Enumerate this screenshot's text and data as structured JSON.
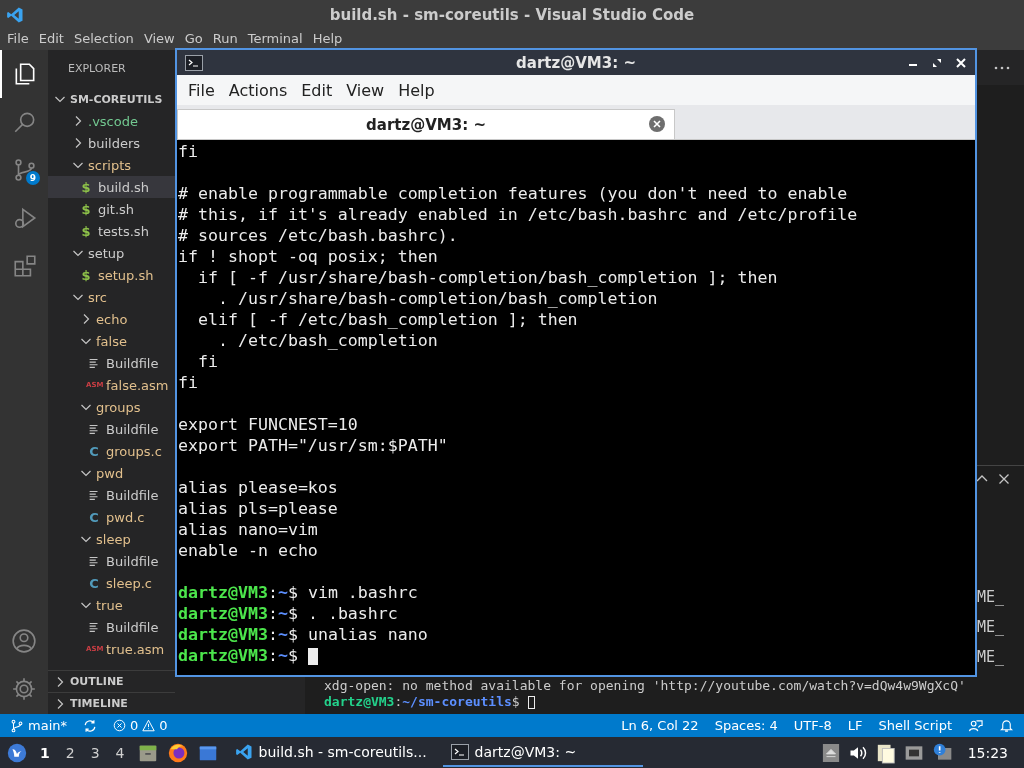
{
  "vscode": {
    "title": "build.sh - sm-coreutils - Visual Studio Code",
    "menu": [
      "File",
      "Edit",
      "Selection",
      "View",
      "Go",
      "Run",
      "Terminal",
      "Help"
    ],
    "activity_bar": [
      {
        "kind": "explorer",
        "selected": true
      },
      {
        "kind": "search",
        "selected": false
      },
      {
        "kind": "source-control",
        "selected": false,
        "badge": "9"
      },
      {
        "kind": "run",
        "selected": false
      },
      {
        "kind": "extensions",
        "selected": false
      }
    ],
    "sidebar": {
      "title": "EXPLORER",
      "root": {
        "label": "SM-COREUTILS",
        "expanded": true,
        "children": [
          {
            "label": ".vscode",
            "kind": "folder",
            "expanded": false,
            "selected": false,
            "color": "#73c991"
          },
          {
            "label": "builders",
            "kind": "folder",
            "expanded": false,
            "selected": false
          },
          {
            "label": "scripts",
            "kind": "folder",
            "expanded": true,
            "selected": false,
            "color": "#e2c08d",
            "children": [
              {
                "label": "build.sh",
                "kind": "shell",
                "icon": "$",
                "selected": true
              },
              {
                "label": "git.sh",
                "kind": "shell",
                "icon": "$",
                "selected": false
              },
              {
                "label": "tests.sh",
                "kind": "shell",
                "icon": "$",
                "selected": false
              }
            ]
          },
          {
            "label": "setup",
            "kind": "folder",
            "expanded": true,
            "selected": false,
            "children": [
              {
                "label": "setup.sh",
                "kind": "shell",
                "icon": "$",
                "selected": false,
                "color": "#e2c08d"
              }
            ]
          },
          {
            "label": "src",
            "kind": "folder",
            "expanded": true,
            "selected": false,
            "color": "#e2c08d",
            "children": [
              {
                "label": "echo",
                "kind": "folder",
                "expanded": false,
                "selected": false,
                "color": "#e2c08d"
              },
              {
                "label": "false",
                "kind": "folder",
                "expanded": true,
                "selected": false,
                "color": "#e2c08d",
                "children": [
                  {
                    "label": "Buildfile",
                    "kind": "buildfile",
                    "selected": false
                  },
                  {
                    "label": "false.asm",
                    "kind": "asm",
                    "icon": "ASM",
                    "selected": false,
                    "color": "#e2c08d"
                  }
                ]
              },
              {
                "label": "groups",
                "kind": "folder",
                "expanded": true,
                "selected": false,
                "color": "#e2c08d",
                "children": [
                  {
                    "label": "Buildfile",
                    "kind": "buildfile",
                    "selected": false
                  },
                  {
                    "label": "groups.c",
                    "kind": "c",
                    "icon": "C",
                    "selected": false,
                    "color": "#e2c08d"
                  }
                ]
              },
              {
                "label": "pwd",
                "kind": "folder",
                "expanded": true,
                "selected": false,
                "color": "#e2c08d",
                "children": [
                  {
                    "label": "Buildfile",
                    "kind": "buildfile",
                    "selected": false
                  },
                  {
                    "label": "pwd.c",
                    "kind": "c",
                    "icon": "C",
                    "selected": false,
                    "color": "#e2c08d"
                  }
                ]
              },
              {
                "label": "sleep",
                "kind": "folder",
                "expanded": true,
                "selected": false,
                "color": "#e2c08d",
                "children": [
                  {
                    "label": "Buildfile",
                    "kind": "buildfile",
                    "selected": false
                  },
                  {
                    "label": "sleep.c",
                    "kind": "c",
                    "icon": "C",
                    "selected": false,
                    "color": "#e2c08d"
                  }
                ]
              },
              {
                "label": "true",
                "kind": "folder",
                "expanded": true,
                "selected": false,
                "color": "#e2c08d",
                "children": [
                  {
                    "label": "Buildfile",
                    "kind": "buildfile",
                    "selected": false
                  },
                  {
                    "label": "true.asm",
                    "kind": "asm",
                    "icon": "ASM",
                    "selected": false,
                    "color": "#e2c08d"
                  }
                ]
              }
            ]
          }
        ]
      },
      "sections": [
        {
          "label": "OUTLINE",
          "expanded": false
        },
        {
          "label": "TIMELINE",
          "expanded": false
        }
      ]
    },
    "panel_fragments": [
      "ME_",
      "ME_",
      "ME_"
    ],
    "panel_lines": [
      {
        "kind": "text",
        "text": "xdg-open: no method available for opening 'http://youtube.com/watch?v=dQw4w9WgXcQ'"
      },
      {
        "kind": "prompt",
        "user": "dartz@VM3",
        "separator": ":",
        "path": "~/sm-coreutils",
        "symbol": "$",
        "cursor": true
      }
    ],
    "status_bar": {
      "branch": "main*",
      "errors": "0",
      "warnings": "0",
      "items": [
        "Ln 6, Col 22",
        "Spaces: 4",
        "UTF-8",
        "LF",
        "Shell Script"
      ]
    }
  },
  "terminal_window": {
    "title": "dartz@VM3: ~",
    "menu": [
      "File",
      "Actions",
      "Edit",
      "View",
      "Help"
    ],
    "tabs": [
      {
        "label": "dartz@VM3: ~",
        "selected": true
      }
    ],
    "lines": [
      {
        "kind": "text",
        "text": "fi"
      },
      {
        "kind": "blank"
      },
      {
        "kind": "text",
        "text": "# enable programmable completion features (you don't need to enable"
      },
      {
        "kind": "text",
        "text": "# this, if it's already enabled in /etc/bash.bashrc and /etc/profile"
      },
      {
        "kind": "text",
        "text": "# sources /etc/bash.bashrc)."
      },
      {
        "kind": "text",
        "text": "if ! shopt -oq posix; then"
      },
      {
        "kind": "text",
        "text": "  if [ -f /usr/share/bash-completion/bash_completion ]; then"
      },
      {
        "kind": "text",
        "text": "    . /usr/share/bash-completion/bash_completion"
      },
      {
        "kind": "text",
        "text": "  elif [ -f /etc/bash_completion ]; then"
      },
      {
        "kind": "text",
        "text": "    . /etc/bash_completion"
      },
      {
        "kind": "text",
        "text": "  fi"
      },
      {
        "kind": "text",
        "text": "fi"
      },
      {
        "kind": "blank"
      },
      {
        "kind": "text",
        "text": "export FUNCNEST=10"
      },
      {
        "kind": "text",
        "text": "export PATH=\"/usr/sm:$PATH\""
      },
      {
        "kind": "blank"
      },
      {
        "kind": "text",
        "text": "alias please=kos"
      },
      {
        "kind": "text",
        "text": "alias pls=please"
      },
      {
        "kind": "text",
        "text": "alias nano=vim"
      },
      {
        "kind": "text",
        "text": "enable -n echo"
      },
      {
        "kind": "blank"
      },
      {
        "kind": "prompt",
        "user": "dartz@VM3",
        "separator": ":",
        "path": "~",
        "symbol": "$",
        "command": "vim .bashrc",
        "cursor": false
      },
      {
        "kind": "prompt",
        "user": "dartz@VM3",
        "separator": ":",
        "path": "~",
        "symbol": "$",
        "command": ". .bashrc",
        "cursor": false
      },
      {
        "kind": "prompt",
        "user": "dartz@VM3",
        "separator": ":",
        "path": "~",
        "symbol": "$",
        "command": "unalias nano",
        "cursor": false
      },
      {
        "kind": "prompt",
        "user": "dartz@VM3",
        "separator": ":",
        "path": "~",
        "symbol": "$",
        "cursor": true
      }
    ]
  },
  "taskbar": {
    "workspaces": [
      {
        "label": "1",
        "selected": true
      },
      {
        "label": "2",
        "selected": false
      },
      {
        "label": "3",
        "selected": false
      },
      {
        "label": "4",
        "selected": false
      }
    ],
    "tasks": [
      {
        "kind": "editor",
        "label": "build.sh - sm-coreutils...",
        "selected": false
      },
      {
        "kind": "terminal",
        "label": "dartz@VM3: ~",
        "selected": true
      }
    ],
    "clock": "15:23"
  }
}
